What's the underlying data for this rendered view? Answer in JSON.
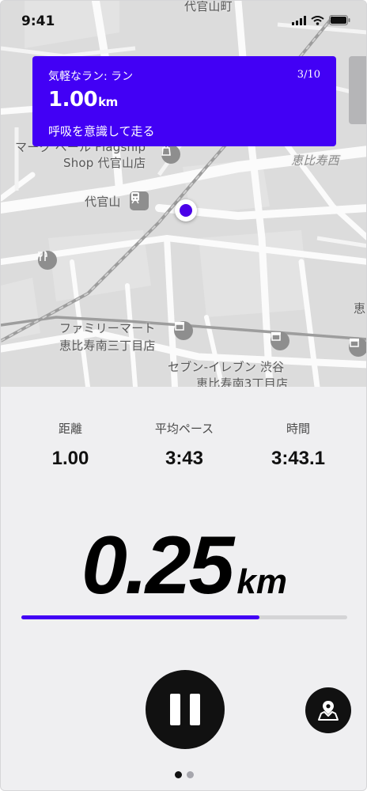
{
  "status_bar": {
    "time": "9:41"
  },
  "map": {
    "labels": {
      "top_road": "代官山町",
      "store_line1": "マーク ベール Flagship",
      "store_line2": "Shop 代官山店",
      "station": "代官山",
      "ebisu_nishi": "恵比寿西",
      "familymart_line1": "ファミリーマート",
      "familymart_line2": "恵比寿南三丁目店",
      "seven_line1": "セブン-イレブン 渋谷",
      "seven_line2": "恵比寿南3丁目店",
      "right_edge_top": "寿",
      "right_edge_mid": "恵"
    }
  },
  "workout_card": {
    "title": "気軽なラン: ラン",
    "step": "3/10",
    "distance_value": "1.00",
    "distance_unit": "km",
    "instruction": "呼吸を意識して走る"
  },
  "stats": {
    "distance": {
      "label": "距離",
      "value": "1.00"
    },
    "avg_pace": {
      "label": "平均ペース",
      "value": "3:43"
    },
    "time": {
      "label": "時間",
      "value": "3:43.1"
    }
  },
  "current_distance": {
    "value": "0.25",
    "unit": "km"
  },
  "progress": {
    "fraction": 0.73
  },
  "pager": {
    "current": 1,
    "total": 2
  },
  "colors": {
    "accent": "#4200f5",
    "dark": "#111111"
  },
  "icons": {
    "pause": "pause-icon",
    "map": "map-pin-icon",
    "poi_rail": "train-icon",
    "poi_food": "fork-knife-icon",
    "poi_store": "store-icon"
  }
}
